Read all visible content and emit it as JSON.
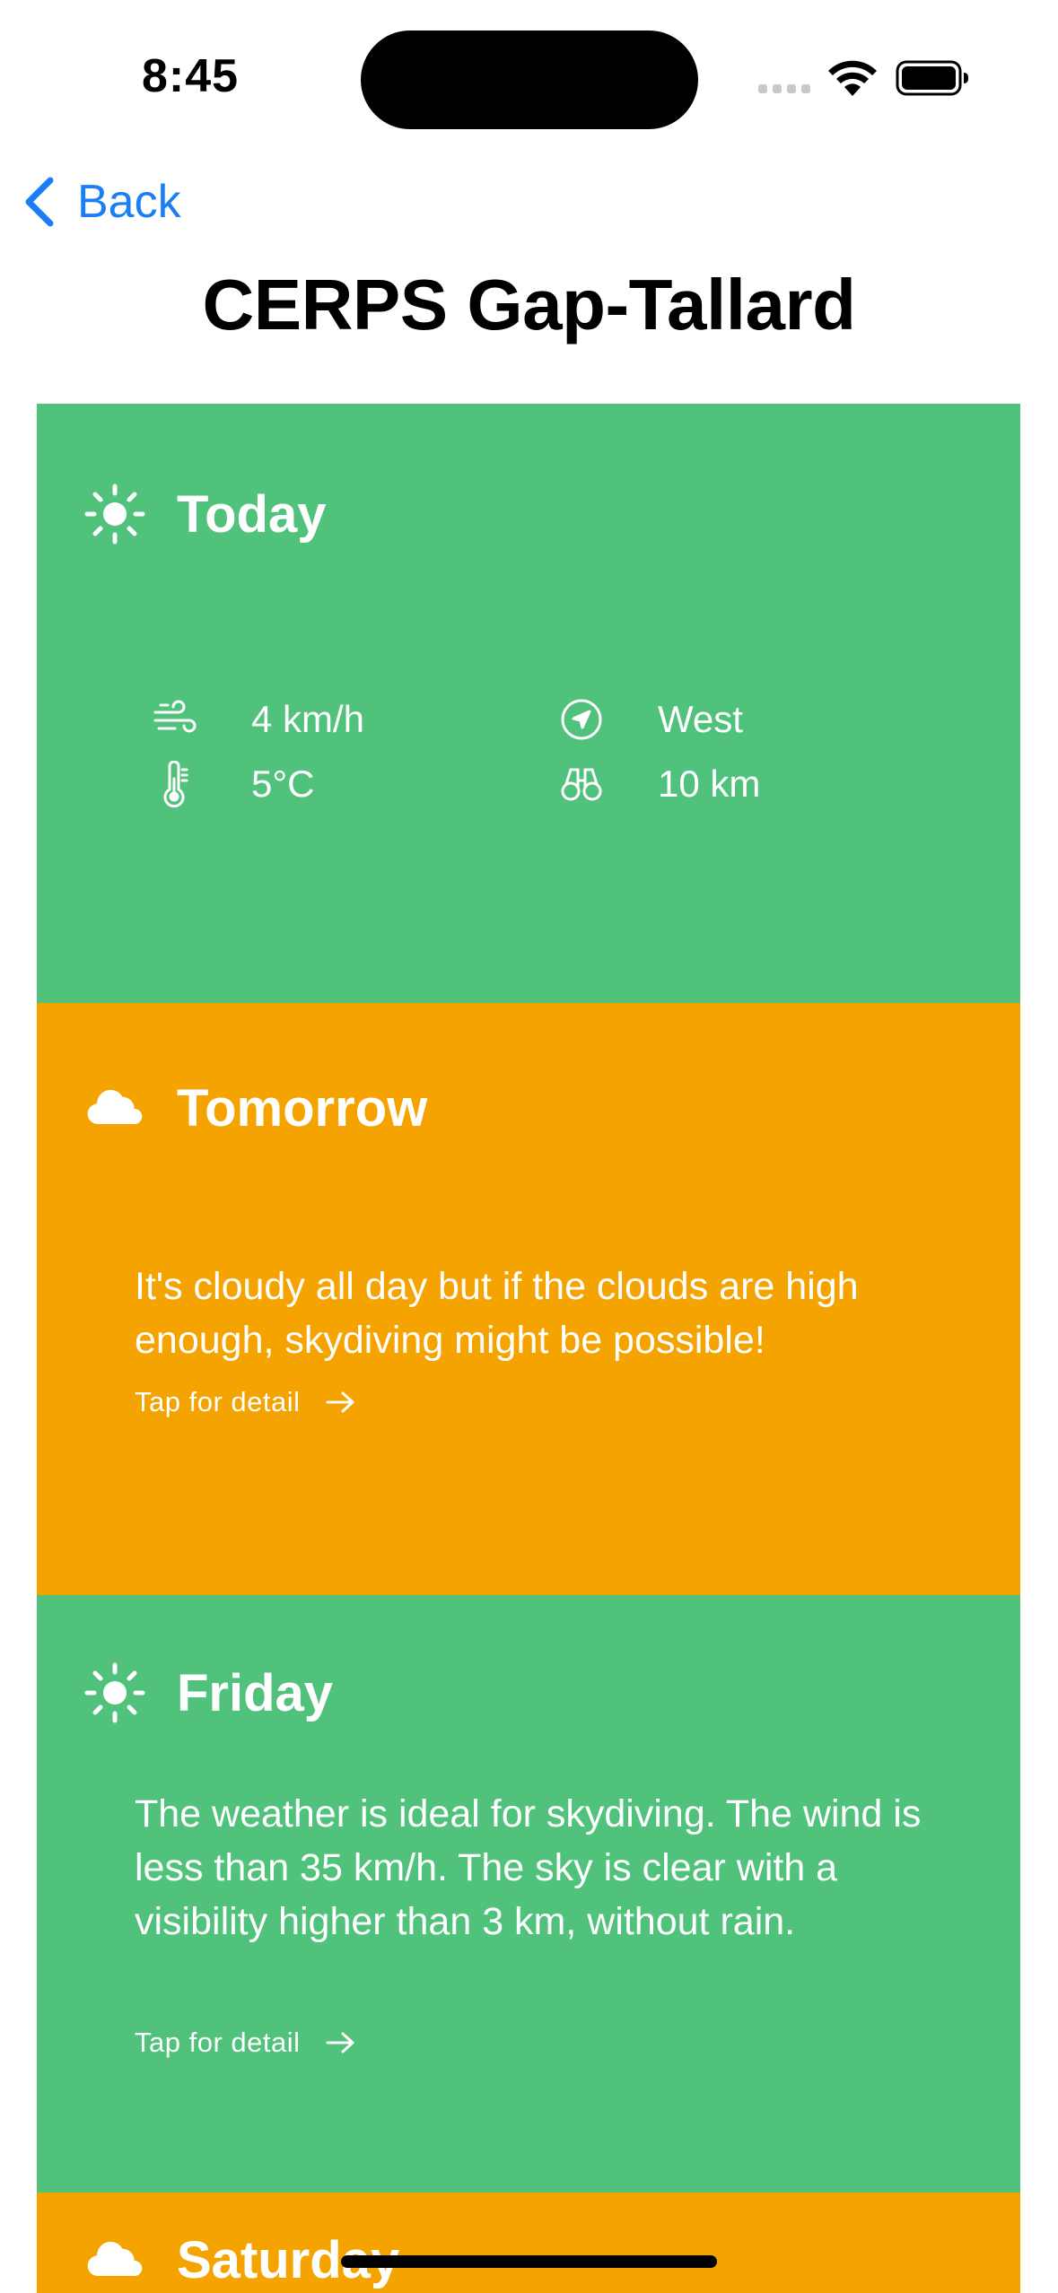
{
  "status_bar": {
    "time": "8:45"
  },
  "nav": {
    "back_label": "Back",
    "title": "CERPS Gap-Tallard"
  },
  "colors": {
    "good": "#51c27c",
    "marginal": "#f4a300",
    "accent": "#1a7ff5"
  },
  "cards": [
    {
      "day": "Today",
      "icon": "sun-icon",
      "stats": {
        "wind_speed": "4 km/h",
        "wind_direction": "West",
        "temperature": "5°C",
        "visibility": "10 km"
      }
    },
    {
      "day": "Tomorrow",
      "icon": "cloud-icon",
      "description": "It's cloudy all day but if the clouds are high enough, skydiving might be possible!",
      "detail_label": "Tap for detail"
    },
    {
      "day": "Friday",
      "icon": "sun-icon",
      "description": "The weather is ideal for skydiving. The wind is less than 35 km/h. The sky is clear with a visibility higher than 3 km, without rain.",
      "detail_label": "Tap for detail"
    },
    {
      "day": "Saturday",
      "icon": "cloud-icon"
    }
  ]
}
